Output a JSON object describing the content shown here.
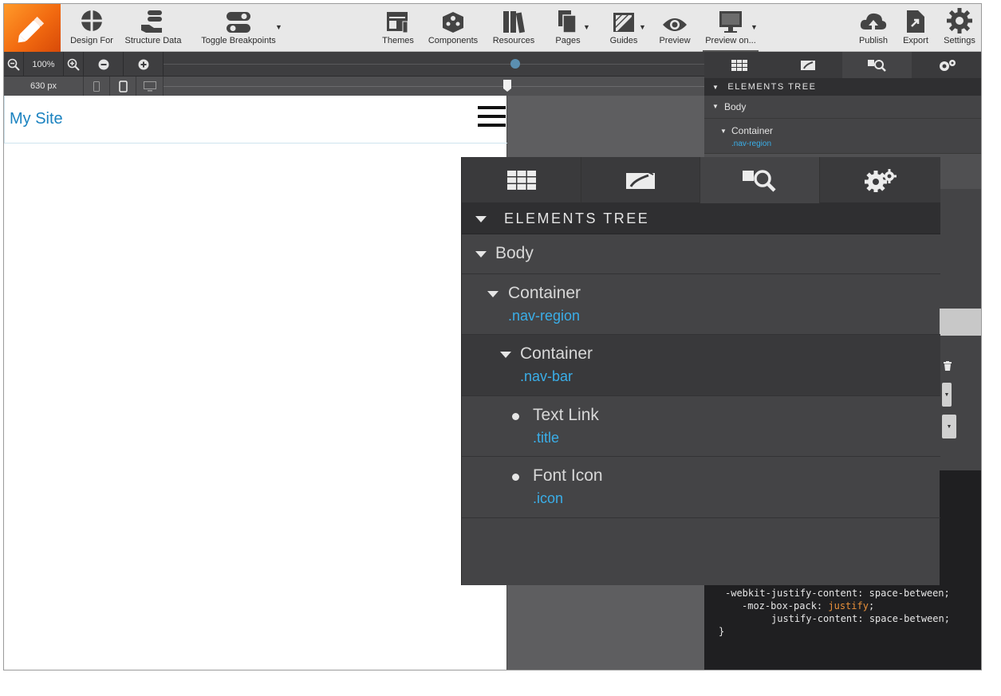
{
  "toolbar": {
    "design_for": "Design For",
    "structure_data": "Structure Data",
    "toggle_breakpoints": "Toggle Breakpoints",
    "themes": "Themes",
    "components": "Components",
    "resources": "Resources",
    "pages": "Pages",
    "guides": "Guides",
    "preview": "Preview",
    "preview_on": "Preview on...",
    "publish": "Publish",
    "export": "Export",
    "settings": "Settings"
  },
  "zoom": {
    "level": "100%"
  },
  "breakpoint": {
    "width": "630 px"
  },
  "site": {
    "title": "My Site"
  },
  "right_panel": {
    "tree_header": "ELEMENTS TREE",
    "body": "Body",
    "container": "Container",
    "container_class": ".nav-region"
  },
  "css_code": {
    "line1": "-webkit-justify-content: space-between;",
    "line2_prop": "-moz-box-pack: ",
    "line2_val": "justify",
    "line2_end": ";",
    "line3": "justify-content: space-between;",
    "line4": "}"
  },
  "zoom_panel": {
    "tree_header": "ELEMENTS TREE",
    "items": [
      {
        "name": "Body",
        "cls": ""
      },
      {
        "name": "Container",
        "cls": ".nav-region"
      },
      {
        "name": "Container",
        "cls": ".nav-bar"
      },
      {
        "name": "Text Link",
        "cls": ".title"
      },
      {
        "name": "Font Icon",
        "cls": ".icon"
      }
    ]
  },
  "colors": {
    "accent_orange": "#f26a10",
    "link_blue": "#1a82c0",
    "class_blue": "#3aaee8",
    "css_value_orange": "#e8903a"
  }
}
